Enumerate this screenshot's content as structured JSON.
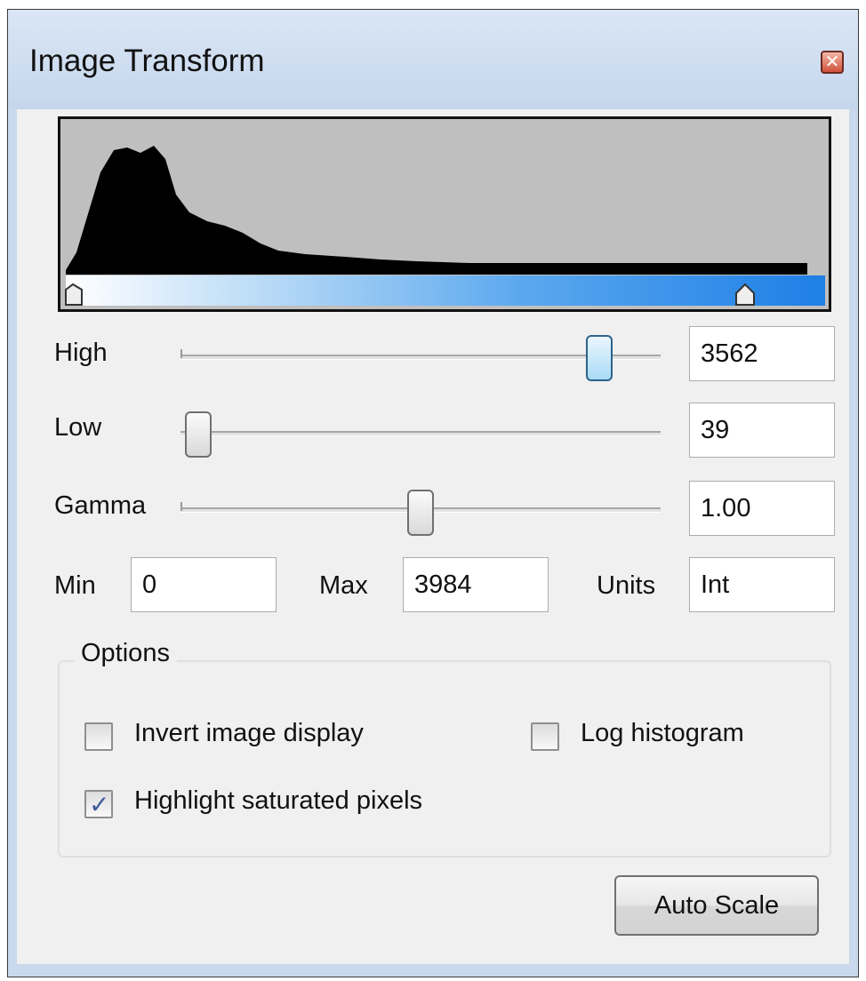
{
  "window": {
    "title": "Image Transform",
    "close_icon": "close-icon"
  },
  "histogram": {
    "description_icon": "histogram",
    "low_marker_value": 39,
    "high_marker_value": 3562,
    "data_range": [
      0,
      3984
    ],
    "colors": {
      "fill": "#000000",
      "background": "#bfbfbf",
      "ramp_start": "#ffffff",
      "ramp_end": "#1e7fe6"
    }
  },
  "high": {
    "label": "High",
    "value": "3562",
    "position": 0.894
  },
  "low": {
    "label": "Low",
    "value": "39",
    "position": 0.01
  },
  "gamma": {
    "label": "Gamma",
    "value": "1.00",
    "position": 0.5
  },
  "range": {
    "min_label": "Min",
    "min_value": "0",
    "max_label": "Max",
    "max_value": "3984",
    "units_label": "Units",
    "units_value": "Int"
  },
  "options": {
    "title": "Options",
    "invert": {
      "label": "Invert image display",
      "checked": false
    },
    "log": {
      "label": "Log histogram",
      "checked": false
    },
    "highlight": {
      "label": "Highlight saturated pixels",
      "checked": true
    }
  },
  "auto_scale_label": "Auto Scale"
}
